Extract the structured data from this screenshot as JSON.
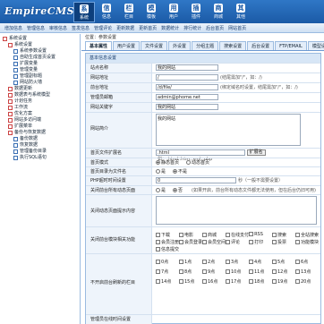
{
  "app": {
    "logo": "EmpireCMS"
  },
  "top_nav": [
    {
      "label": "系统",
      "icon": "系"
    },
    {
      "label": "信息",
      "icon": "信"
    },
    {
      "label": "栏目",
      "icon": "栏"
    },
    {
      "label": "模板",
      "icon": "模"
    },
    {
      "label": "用户",
      "icon": "用"
    },
    {
      "label": "插件",
      "icon": "插"
    },
    {
      "label": "商城",
      "icon": "商"
    },
    {
      "label": "其他",
      "icon": "其"
    }
  ],
  "sub_nav": [
    "增加信息",
    "管理信息",
    "审核信息",
    "签发信息",
    "管理评论",
    "更新数据",
    "更新首页",
    "数据统计",
    "排行统计",
    "后台首页",
    "网站首页"
  ],
  "sidebar": [
    {
      "label": "系统设置",
      "level": 0
    },
    {
      "label": "系统设置",
      "level": 1
    },
    {
      "label": "系统参数设置",
      "level": 2
    },
    {
      "label": "自助生成首页设置",
      "level": 2
    },
    {
      "label": "扩展变量",
      "level": 2
    },
    {
      "label": "管理变量",
      "level": 2
    },
    {
      "label": "管理副标题",
      "level": 2
    },
    {
      "label": "网站防火墙",
      "level": 2
    },
    {
      "label": "数据更新",
      "level": 1
    },
    {
      "label": "数据表与系统模型",
      "level": 1
    },
    {
      "label": "计划任务",
      "level": 1
    },
    {
      "label": "工作流",
      "level": 1
    },
    {
      "label": "优化方案",
      "level": 1
    },
    {
      "label": "网站多访问端",
      "level": 1
    },
    {
      "label": "扩展菜单",
      "level": 1
    },
    {
      "label": "备份与恢复数据",
      "level": 1
    },
    {
      "label": "备份数据",
      "level": 2
    },
    {
      "label": "恢复数据",
      "level": 2
    },
    {
      "label": "管理备份目录",
      "level": 2
    },
    {
      "label": "执行SQL语句",
      "level": 2
    }
  ],
  "breadcrumb": "位置：参数设置",
  "tabs": [
    "基本属性",
    "用户设置",
    "文件设置",
    "外设置",
    "分组主题",
    "搜索设置",
    "后台设置",
    "FTP/EMAIL",
    "模型设置"
  ],
  "form": {
    "header": "基本信息设置",
    "site_name": {
      "label": "站点名称",
      "value": "我的网站"
    },
    "site_url": {
      "label": "网站地址",
      "value": "/",
      "hint": "(结尾需加\"/\"，如：/)"
    },
    "home_url": {
      "label": "前台地址",
      "value": "/d/file/",
      "hint": "(绑定域名时设置，结尾需加\"/\"，如：/)"
    },
    "admin_email": {
      "label": "管理员邮箱",
      "value": "admin@phome.net"
    },
    "keywords": {
      "label": "网站关键字",
      "value": "我的网站"
    },
    "description": {
      "label": "网站简介",
      "value": "我的网站"
    },
    "index_file_ext": {
      "label": "首页文件扩展名",
      "value": ".html",
      "select": "扩展名",
      "hint": "如：.html,.htm,.xml,.php"
    },
    "index_mode": {
      "label": "首页模式",
      "options": [
        "静态首页",
        "动态首页"
      ],
      "selected": 0
    },
    "dir_default_file": {
      "label": "首页目录为文件名",
      "options": [
        "是",
        "不是"
      ],
      "selected": 1
    },
    "php_timeout": {
      "label": "PHP超时时间设置",
      "value": "0",
      "hint": "秒（一般不需要设置）"
    },
    "close_front": {
      "label": "关闭前台所有动态页面",
      "options": [
        "是",
        "否"
      ],
      "selected": 1,
      "hint": "(如果开启，前台所有动态文件都无法使用，但在后台仍旧可用)"
    },
    "close_tip": {
      "label": "关闭动态页面提示内容"
    },
    "close_modules": {
      "label": "关闭前台模块相关功能",
      "items": [
        "下载",
        "电影",
        "商城",
        "在线支付",
        "RSS",
        "搜索",
        "全站搜索",
        "会员注册",
        "会员登录",
        "会员空间",
        "评论",
        "打印",
        "投票",
        "功能模块",
        "信息提交"
      ]
    },
    "no_refresh": {
      "label": "不开启前台刷新的栏目",
      "items": [
        "0点",
        "1点",
        "2点",
        "3点",
        "4点",
        "5点",
        "6点",
        "7点",
        "8点",
        "9点",
        "10点",
        "11点",
        "12点",
        "13点",
        "14点",
        "15点",
        "16点",
        "17点",
        "18点",
        "19点",
        "20点"
      ]
    },
    "last_row": {
      "label": "管理员在线时间设置"
    }
  }
}
